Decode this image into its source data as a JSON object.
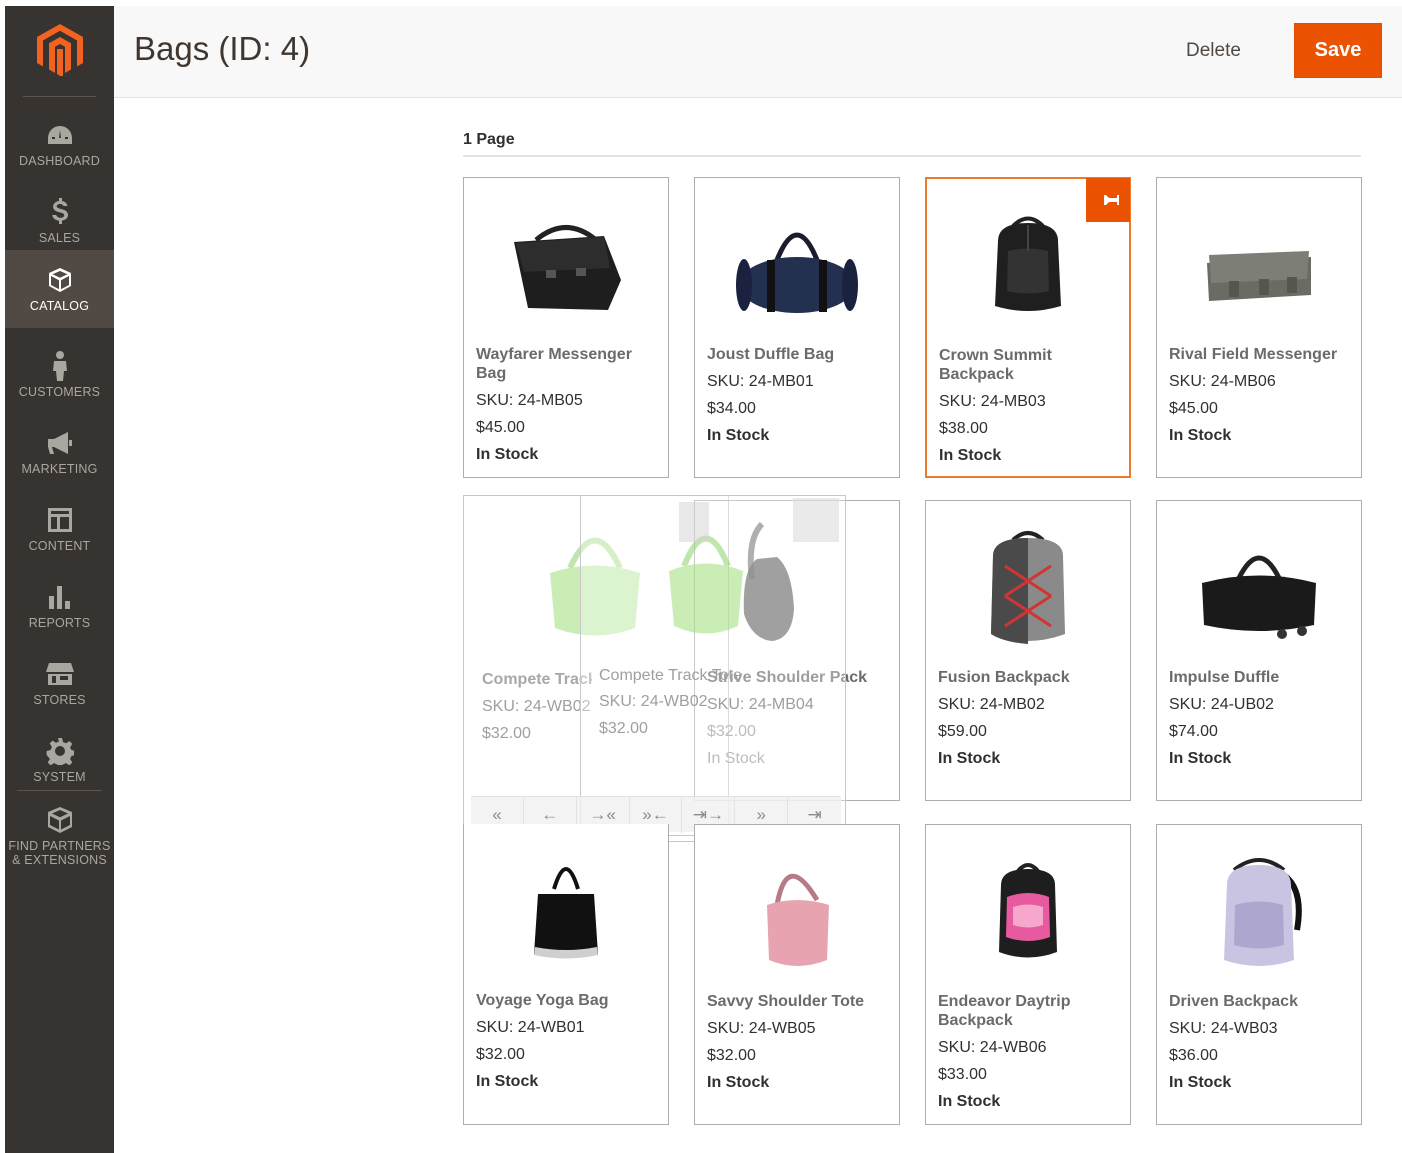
{
  "sidebar": {
    "items": [
      {
        "label": "DASHBOARD",
        "icon": "dashboard-icon"
      },
      {
        "label": "SALES",
        "icon": "dollar-icon"
      },
      {
        "label": "CATALOG",
        "icon": "box-icon",
        "active": true
      },
      {
        "label": "CUSTOMERS",
        "icon": "person-icon"
      },
      {
        "label": "MARKETING",
        "icon": "megaphone-icon"
      },
      {
        "label": "CONTENT",
        "icon": "layout-icon"
      },
      {
        "label": "REPORTS",
        "icon": "bar-chart-icon"
      },
      {
        "label": "STORES",
        "icon": "store-icon"
      },
      {
        "label": "SYSTEM",
        "icon": "gear-icon"
      }
    ],
    "extensions": {
      "line1": "FIND PARTNERS",
      "line2": "& EXTENSIONS",
      "icon": "partners-box-icon"
    }
  },
  "header": {
    "title": "Bags (ID: 4)",
    "delete_label": "Delete",
    "save_label": "Save"
  },
  "section": {
    "title": "1 Page"
  },
  "products": [
    {
      "name": "Wayfarer Messenger Bag",
      "sku": "SKU: 24-MB05",
      "price": "$45.00",
      "stock": "In Stock"
    },
    {
      "name": "Joust Duffle Bag",
      "sku": "SKU: 24-MB01",
      "price": "$34.00",
      "stock": "In Stock"
    },
    {
      "name": "Crown Summit Backpack",
      "sku": "SKU: 24-MB03",
      "price": "$38.00",
      "stock": "In Stock",
      "pinned": true
    },
    {
      "name": "Rival Field Messenger",
      "sku": "SKU: 24-MB06",
      "price": "$45.00",
      "stock": "In Stock"
    },
    {
      "name": "Fusion Backpack",
      "sku": "SKU: 24-MB02",
      "price": "$59.00",
      "stock": "In Stock"
    },
    {
      "name": "Impulse Duffle",
      "sku": "SKU: 24-UB02",
      "price": "$74.00",
      "stock": "In Stock"
    },
    {
      "name": "Voyage Yoga Bag",
      "sku": "SKU: 24-WB01",
      "price": "$32.00",
      "stock": "In Stock"
    },
    {
      "name": "Savvy Shoulder Tote",
      "sku": "SKU: 24-WB05",
      "price": "$32.00",
      "stock": "In Stock"
    },
    {
      "name": "Endeavor Daytrip Backpack",
      "sku": "SKU: 24-WB06",
      "price": "$33.00",
      "stock": "In Stock"
    },
    {
      "name": "Driven Backpack",
      "sku": "SKU: 24-WB03",
      "price": "$36.00",
      "stock": "In Stock"
    }
  ],
  "dragging": {
    "source": {
      "name": "Compete Track Tote",
      "sku": "SKU: 24-WB02",
      "price": "$32.00"
    },
    "ghost": {
      "name": "Compete Track Tote",
      "sku": "SKU: 24-WB02",
      "price": "$32.00"
    },
    "under": {
      "name": "Strive Shoulder Pack",
      "sku": "SKU: 24-MB04",
      "price": "$32.00",
      "stock": "In Stock"
    },
    "toolbar": [
      "«",
      "←",
      "→«",
      "»←",
      "⇥→",
      "»",
      "⇥"
    ]
  },
  "colors": {
    "accent": "#eb5202",
    "sidebar": "#373330",
    "sidebar_active": "#514943"
  }
}
